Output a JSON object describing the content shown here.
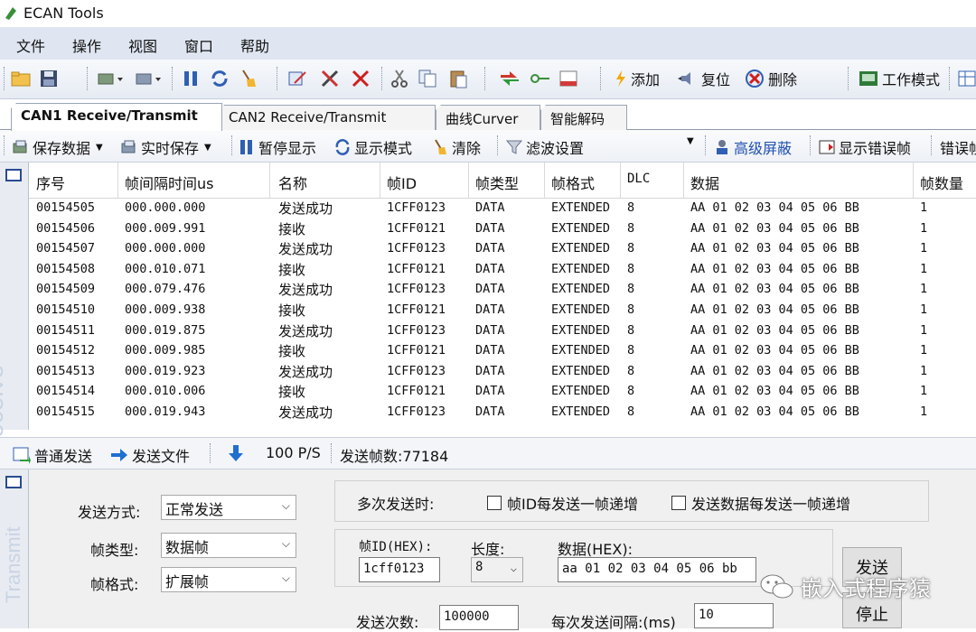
{
  "window": {
    "title": "ECAN Tools"
  },
  "menu": [
    "文件",
    "操作",
    "视图",
    "窗口",
    "帮助"
  ],
  "toolbar": {
    "add_label": "添加",
    "reset_label": "复位",
    "delete_label": "删除",
    "workmode_label": "工作模式"
  },
  "tabs": [
    "CAN1 Receive/Transmit",
    "CAN2 Receive/Transmit",
    "曲线Curver",
    "智能解码"
  ],
  "rx_toolbar": {
    "save_data": "保存数据",
    "realtime_save": "实时保存",
    "pause_display": "暂停显示",
    "display_mode": "显示模式",
    "clear": "清除",
    "filter_settings": "滤波设置",
    "advanced_mask": "高级屏蔽",
    "show_error_frames": "显示错误帧",
    "error": "错误帧"
  },
  "rx_side_label": "Receive",
  "table": {
    "headers": [
      "序号",
      "帧间隔时间us",
      "名称",
      "帧ID",
      "帧类型",
      "帧格式",
      "DLC",
      "数据",
      "帧数量"
    ],
    "rows": [
      [
        "00154505",
        "000.000.000",
        "发送成功",
        "1CFF0123",
        "DATA",
        "EXTENDED",
        "8",
        "AA 01 02 03 04 05 06 BB",
        "1"
      ],
      [
        "00154506",
        "000.009.991",
        "接收",
        "1CFF0121",
        "DATA",
        "EXTENDED",
        "8",
        "AA 01 02 03 04 05 06 BB",
        "1"
      ],
      [
        "00154507",
        "000.000.000",
        "发送成功",
        "1CFF0123",
        "DATA",
        "EXTENDED",
        "8",
        "AA 01 02 03 04 05 06 BB",
        "1"
      ],
      [
        "00154508",
        "000.010.071",
        "接收",
        "1CFF0121",
        "DATA",
        "EXTENDED",
        "8",
        "AA 01 02 03 04 05 06 BB",
        "1"
      ],
      [
        "00154509",
        "000.079.476",
        "发送成功",
        "1CFF0123",
        "DATA",
        "EXTENDED",
        "8",
        "AA 01 02 03 04 05 06 BB",
        "1"
      ],
      [
        "00154510",
        "000.009.938",
        "接收",
        "1CFF0121",
        "DATA",
        "EXTENDED",
        "8",
        "AA 01 02 03 04 05 06 BB",
        "1"
      ],
      [
        "00154511",
        "000.019.875",
        "发送成功",
        "1CFF0123",
        "DATA",
        "EXTENDED",
        "8",
        "AA 01 02 03 04 05 06 BB",
        "1"
      ],
      [
        "00154512",
        "000.009.985",
        "接收",
        "1CFF0121",
        "DATA",
        "EXTENDED",
        "8",
        "AA 01 02 03 04 05 06 BB",
        "1"
      ],
      [
        "00154513",
        "000.019.923",
        "发送成功",
        "1CFF0123",
        "DATA",
        "EXTENDED",
        "8",
        "AA 01 02 03 04 05 06 BB",
        "1"
      ],
      [
        "00154514",
        "000.010.006",
        "接收",
        "1CFF0121",
        "DATA",
        "EXTENDED",
        "8",
        "AA 01 02 03 04 05 06 BB",
        "1"
      ],
      [
        "00154515",
        "000.019.943",
        "发送成功",
        "1CFF0123",
        "DATA",
        "EXTENDED",
        "8",
        "AA 01 02 03 04 05 06 BB",
        "1"
      ]
    ]
  },
  "tx_toolbar": {
    "normal_send": "普通发送",
    "send_file": "发送文件",
    "rate": "100 P/S",
    "sent_count": "发送帧数:77184"
  },
  "tx_side_label": "Transmit",
  "transmit": {
    "send_mode_label": "发送方式:",
    "send_mode_value": "正常发送",
    "frame_type_label": "帧类型:",
    "frame_type_value": "数据帧",
    "frame_format_label": "帧格式:",
    "frame_format_value": "扩展帧",
    "multi_send_label": "多次发送时:",
    "inc_id_label": "帧ID每发送一帧递增",
    "inc_data_label": "发送数据每发送一帧递增",
    "frame_id_label": "帧ID(HEX):",
    "frame_id_value": "1cff0123",
    "length_label": "长度:",
    "length_value": "8",
    "data_label": "数据(HEX):",
    "data_value": "aa 01 02 03 04 05 06 bb",
    "send_count_label": "发送次数:",
    "send_count_value": "100000",
    "interval_label": "每次发送间隔:(ms)",
    "interval_value": "10",
    "send_button": "发送",
    "stop_button": "停止"
  },
  "watermark": "嵌入式程序猿"
}
